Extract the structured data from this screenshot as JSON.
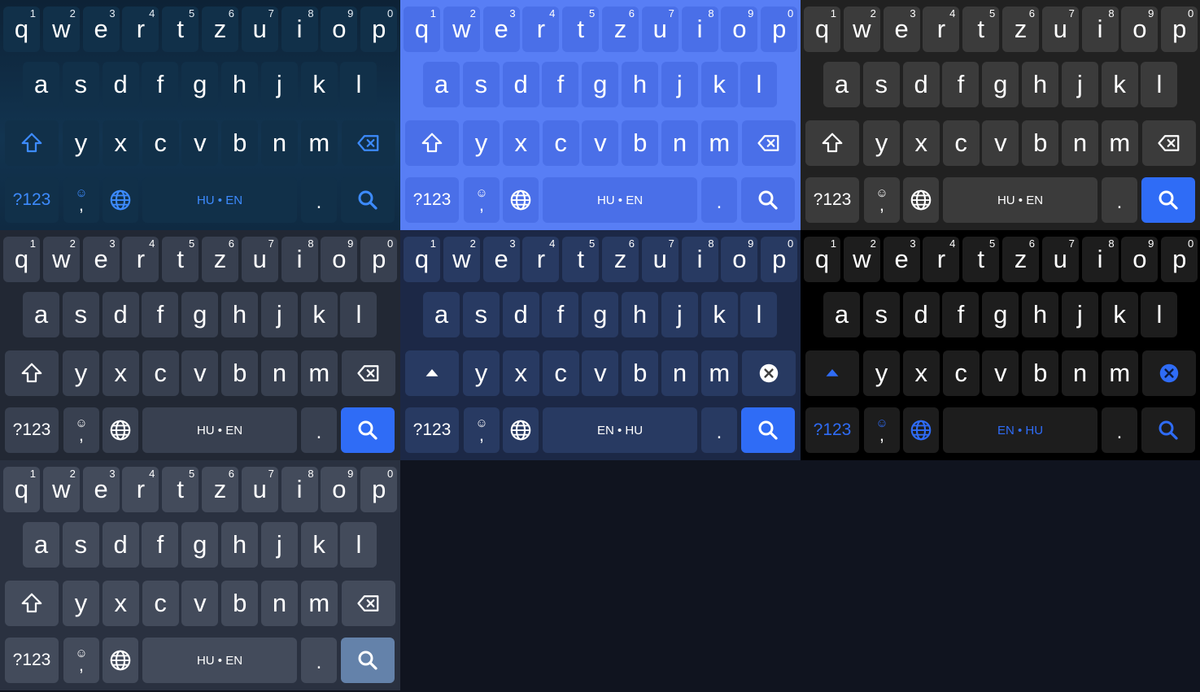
{
  "keys": {
    "row1": [
      "q",
      "w",
      "e",
      "r",
      "t",
      "z",
      "u",
      "i",
      "o",
      "p"
    ],
    "row1_hints": [
      "1",
      "2",
      "3",
      "4",
      "5",
      "6",
      "7",
      "8",
      "9",
      "0"
    ],
    "row2": [
      "a",
      "s",
      "d",
      "f",
      "g",
      "h",
      "j",
      "k",
      "l"
    ],
    "row3": [
      "y",
      "x",
      "c",
      "v",
      "b",
      "n",
      "m"
    ],
    "sym_label": "?123",
    "emoji_glyph": "☺",
    "comma_label": ",",
    "period_label": "."
  },
  "icons": {
    "shift": "shift-icon",
    "backspace": "backspace-icon",
    "globe": "globe-icon",
    "search": "search-icon"
  },
  "themes": [
    {
      "id": "theme-1",
      "space_label": "HU • EN",
      "bg": "#0f2a3f",
      "key": "#113049",
      "func": "#113049",
      "text": "#ffffff",
      "hint": "#e6eef5",
      "accent_text": "#3d8bff",
      "shift_style": "outline",
      "shift_color": "#3d8bff",
      "back_color": "#3d8bff",
      "back_style": "outline",
      "globe_color": "#3d8bff",
      "action_bg": "#113049",
      "action_icon": "#3d8bff",
      "sym_color": "#3d8bff",
      "space_text": "#3d8bff",
      "bg_gradient": true
    },
    {
      "id": "theme-2",
      "space_label": "HU • EN",
      "bg": "#587ef5",
      "key": "#4a6fe8",
      "func": "#4a6fe8",
      "text": "#ffffff",
      "hint": "#ffffff",
      "accent_text": "#ffffff",
      "shift_style": "outline",
      "shift_color": "#ffffff",
      "back_color": "#ffffff",
      "back_style": "outline",
      "globe_color": "#ffffff",
      "action_bg": "#4a6fe8",
      "action_icon": "#ffffff",
      "sym_color": "#ffffff",
      "space_text": "#ffffff",
      "bg_gradient": false
    },
    {
      "id": "theme-3",
      "space_label": "HU • EN",
      "bg": "#212121",
      "key": "#3b3b3b",
      "func": "#3b3b3b",
      "text": "#ffffff",
      "hint": "#ffffff",
      "accent_text": "#ffffff",
      "shift_style": "outline",
      "shift_color": "#ffffff",
      "back_color": "#ffffff",
      "back_style": "outline",
      "globe_color": "#ffffff",
      "action_bg": "#2f6cf6",
      "action_icon": "#ffffff",
      "sym_color": "#ffffff",
      "space_text": "#ffffff",
      "bg_gradient": false
    },
    {
      "id": "theme-4",
      "space_label": "HU • EN",
      "bg": "#222834",
      "key": "#384050",
      "func": "#384050",
      "text": "#ffffff",
      "hint": "#ffffff",
      "accent_text": "#ffffff",
      "shift_style": "outline",
      "shift_color": "#ffffff",
      "back_color": "#ffffff",
      "back_style": "outline",
      "globe_color": "#ffffff",
      "action_bg": "#2f6cf6",
      "action_icon": "#ffffff",
      "sym_color": "#ffffff",
      "space_text": "#ffffff",
      "bg_gradient": false
    },
    {
      "id": "theme-5",
      "space_label": "EN • HU",
      "bg": "#1c2846",
      "key": "#283a62",
      "func": "#283a62",
      "text": "#ffffff",
      "hint": "#ffffff",
      "accent_text": "#ffffff",
      "shift_style": "filled",
      "shift_color": "#ffffff",
      "back_color": "#ffffff",
      "back_style": "filled",
      "globe_color": "#ffffff",
      "action_bg": "#2f6cf6",
      "action_icon": "#ffffff",
      "sym_color": "#ffffff",
      "space_text": "#ffffff",
      "bg_gradient": false
    },
    {
      "id": "theme-6",
      "space_label": "EN • HU",
      "bg": "#000000",
      "key": "#1d1d1d",
      "func": "#1d1d1d",
      "text": "#ffffff",
      "hint": "#ffffff",
      "accent_text": "#2f6cf6",
      "shift_style": "filled",
      "shift_color": "#2f6cf6",
      "back_color": "#2f6cf6",
      "back_style": "filled",
      "globe_color": "#2f6cf6",
      "action_bg": "#1d1d1d",
      "action_icon": "#2f6cf6",
      "sym_color": "#2f6cf6",
      "space_text": "#2f6cf6",
      "bg_gradient": false
    },
    {
      "id": "theme-7",
      "space_label": "HU • EN",
      "bg": "#2a3140",
      "key": "#434b5b",
      "func": "#434b5b",
      "text": "#ffffff",
      "hint": "#ffffff",
      "accent_text": "#ffffff",
      "shift_style": "outline",
      "shift_color": "#ffffff",
      "back_color": "#ffffff",
      "back_style": "outline",
      "globe_color": "#ffffff",
      "action_bg": "#6482aa",
      "action_icon": "#ffffff",
      "sym_color": "#ffffff",
      "space_text": "#ffffff",
      "bg_gradient": false
    }
  ]
}
